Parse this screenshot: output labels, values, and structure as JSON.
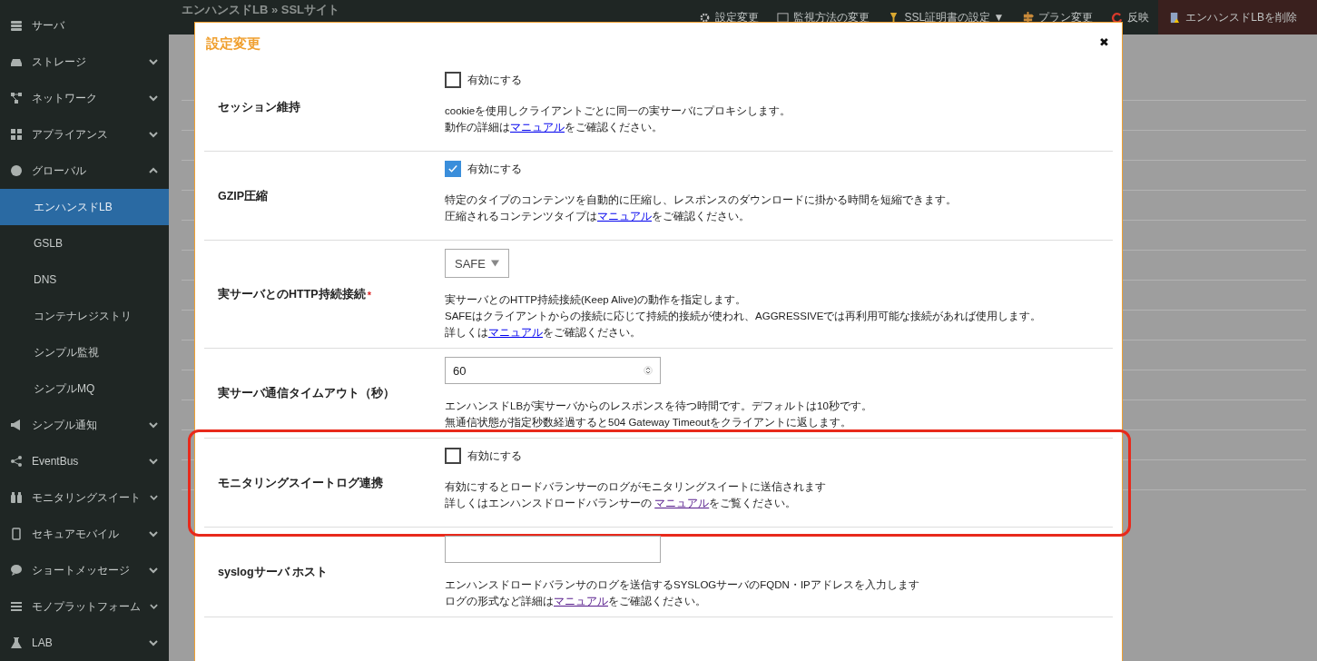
{
  "sidebar": {
    "items": [
      {
        "label": "サーバ",
        "kind": "link",
        "selected": false
      },
      {
        "label": "ストレージ",
        "kind": "group",
        "expanded": false,
        "selected": false
      },
      {
        "label": "ネットワーク",
        "kind": "group",
        "expanded": false,
        "selected": false
      },
      {
        "label": "アプライアンス",
        "kind": "group",
        "expanded": false,
        "selected": false
      },
      {
        "label": "グローバル",
        "kind": "group",
        "expanded": true,
        "selected": false,
        "children": [
          {
            "label": "エンハンスドLB",
            "selected": true
          },
          {
            "label": "GSLB",
            "selected": false
          },
          {
            "label": "DNS",
            "selected": false
          },
          {
            "label": "コンテナレジストリ",
            "selected": false
          },
          {
            "label": "シンプル監視",
            "selected": false
          },
          {
            "label": "シンプルMQ",
            "selected": false
          }
        ]
      },
      {
        "label": "シンプル通知",
        "kind": "group",
        "expanded": false,
        "selected": false
      },
      {
        "label": "EventBus",
        "kind": "group",
        "expanded": false,
        "selected": false
      },
      {
        "label": "モニタリングスイート",
        "kind": "group",
        "expanded": false,
        "selected": false
      },
      {
        "label": "セキュアモバイル",
        "kind": "group",
        "expanded": false,
        "selected": false
      },
      {
        "label": "ショートメッセージ",
        "kind": "group",
        "expanded": false,
        "selected": false
      },
      {
        "label": "モノプラットフォーム",
        "kind": "group",
        "expanded": false,
        "selected": false
      },
      {
        "label": "LAB",
        "kind": "group",
        "expanded": false,
        "selected": false
      }
    ]
  },
  "breadcrumb": "エンハンスドLB » SSLサイト",
  "toolbar": [
    "設定変更",
    "監視方法の変更",
    "SSL証明書の設定 ▼",
    "プラン変更",
    "反映",
    "エンハンスドLBを削除"
  ],
  "modal": {
    "title": "設定変更",
    "close": "✖",
    "rows": [
      {
        "label": "セッション維持",
        "kind": "checkbox",
        "checked": false,
        "option": "有効にする",
        "lines": [
          {
            "text": "cookieを使用しクライアントごとに同一の実サーバにプロキシします。"
          },
          {
            "pre": "動作の詳細は",
            "link": "マニュアル",
            "visited": false,
            "post": "をご確認ください。"
          }
        ]
      },
      {
        "label": "GZIP圧縮",
        "kind": "checkbox",
        "checked": true,
        "option": "有効にする",
        "lines": [
          {
            "text": "特定のタイプのコンテンツを自動的に圧縮し、レスポンスのダウンロードに掛かる時間を短縮できます。"
          },
          {
            "pre": "圧縮されるコンテンツタイプは",
            "link": "マニュアル",
            "visited": false,
            "post": "をご確認ください。"
          }
        ]
      },
      {
        "label": "実サーバとのHTTP持続接続",
        "required_mark": "*",
        "kind": "select",
        "value": "SAFE",
        "lines": [
          {
            "text": "実サーバとのHTTP持続接続(Keep Alive)の動作を指定します。"
          },
          {
            "text": "SAFEはクライアントからの接続に応じて持続的接続が使われ、AGGRESSIVEでは再利用可能な接続があれば使用します。"
          },
          {
            "pre": "詳しくは",
            "link": "マニュアル",
            "visited": false,
            "post": "をご確認ください。"
          }
        ]
      },
      {
        "label": "実サーバ通信タイムアウト（秒）",
        "kind": "number",
        "value": "60",
        "lines": [
          {
            "text": "エンハンスドLBが実サーバからのレスポンスを待つ時間です。デフォルトは10秒です。"
          },
          {
            "text": "無通信状態が指定秒数経過すると504 Gateway Timeoutをクライアントに返します。"
          }
        ]
      },
      {
        "label": "モニタリングスイートログ連携",
        "kind": "checkbox",
        "checked": false,
        "option": "有効にする",
        "highlighted": true,
        "lines": [
          {
            "text": "有効にするとロードバランサーのログがモニタリングスイートに送信されます"
          },
          {
            "pre": "詳しくはエンハンスドロードバランサーの ",
            "link": "マニュアル",
            "visited": true,
            "post": "をご覧ください。"
          }
        ]
      },
      {
        "label": "syslogサーバ ホスト",
        "kind": "text",
        "lines": [
          {
            "text": "エンハンスドロードバランサのログを送信するSYSLOGサーバのFQDN・IPアドレスを入力します"
          },
          {
            "pre": "ログの形式など詳細は",
            "link": "マニュアル",
            "visited": true,
            "post": "をご確認ください。"
          }
        ]
      }
    ]
  }
}
